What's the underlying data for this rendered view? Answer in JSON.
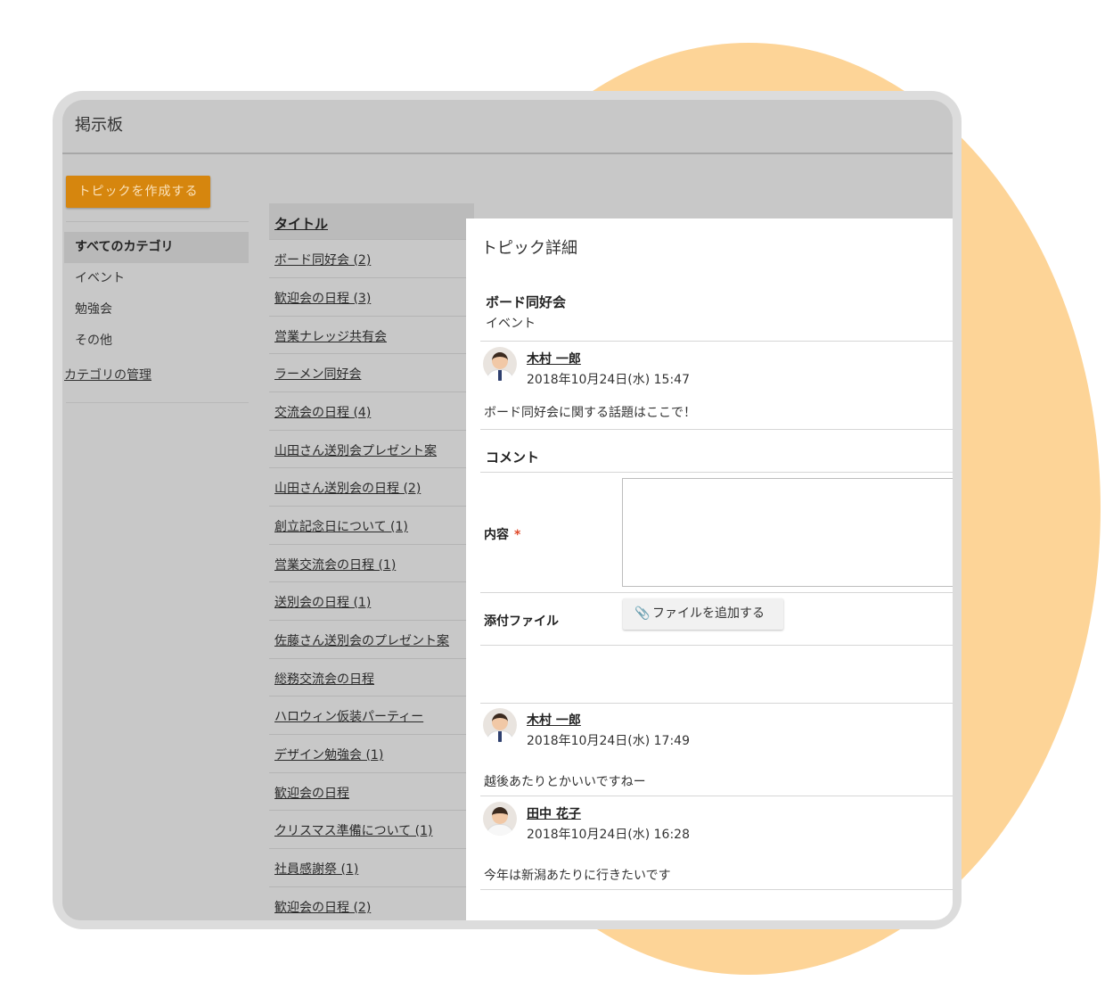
{
  "app": {
    "title": "掲示板"
  },
  "sidebar": {
    "create_button": "トピックを作成する",
    "categories": [
      {
        "label": "すべてのカテゴリ",
        "active": true
      },
      {
        "label": "イベント",
        "active": false
      },
      {
        "label": "勉強会",
        "active": false
      },
      {
        "label": "その他",
        "active": false
      }
    ],
    "manage_link": "カテゴリの管理"
  },
  "topic_list": {
    "header": "タイトル",
    "items": [
      "ボード同好会 (2)",
      "歓迎会の日程 (3)",
      "営業ナレッジ共有会",
      "ラーメン同好会",
      "交流会の日程 (4)",
      "山田さん送別会プレゼント案",
      "山田さん送別会の日程 (2)",
      "創立記念日について (1)",
      "営業交流会の日程 (1)",
      "送別会の日程 (1)",
      "佐藤さん送別会のプレゼント案",
      "総務交流会の日程",
      "ハロウィン仮装パーティー",
      "デザイン勉強会 (1)",
      "歓迎会の日程",
      "クリスマス準備について (1)",
      "社員感謝祭 (1)",
      "歓迎会の日程 (2)"
    ]
  },
  "detail": {
    "panel_title": "トピック詳細",
    "topic_title": "ボード同好会",
    "topic_category": "イベント",
    "post": {
      "author": "木村 一郎",
      "date": "2018年10月24日(水) 15:47",
      "body": "ボード同好会に関する話題はここで！"
    },
    "comment_form": {
      "section_title": "コメント",
      "content_label": "内容",
      "required_mark": "*",
      "attach_label": "添付ファイル",
      "add_file_button": "ファイルを追加する"
    },
    "comments": [
      {
        "author": "木村 一郎",
        "date": "2018年10月24日(水) 17:49",
        "body": "越後あたりとかいいですねー"
      },
      {
        "author": "田中 花子",
        "date": "2018年10月24日(水) 16:28",
        "body": "今年は新潟あたりに行きたいです"
      }
    ]
  },
  "colors": {
    "accent": "#d6860e",
    "background_circle": "#fdd497",
    "screen_bg": "#c8c8c8"
  },
  "icons": {
    "attach": "paperclip-icon"
  }
}
